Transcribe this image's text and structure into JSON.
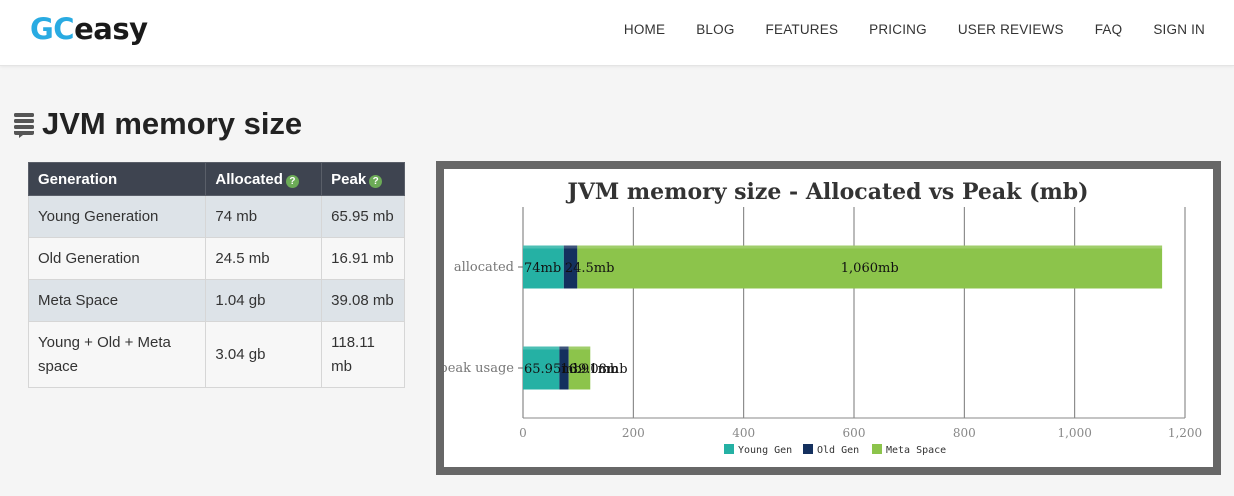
{
  "header": {
    "logo_gc": "GC",
    "logo_easy": "easy",
    "nav": [
      "HOME",
      "BLOG",
      "FEATURES",
      "PRICING",
      "USER REVIEWS",
      "FAQ",
      "SIGN IN"
    ]
  },
  "page": {
    "title": "JVM memory size"
  },
  "table": {
    "headers": [
      "Generation",
      "Allocated",
      "Peak"
    ],
    "rows": [
      {
        "generation": "Young Generation",
        "allocated": "74 mb",
        "peak": "65.95 mb"
      },
      {
        "generation": "Old Generation",
        "allocated": "24.5 mb",
        "peak": "16.91 mb"
      },
      {
        "generation": "Meta Space",
        "allocated": "1.04 gb",
        "peak": "39.08 mb"
      },
      {
        "generation": "Young + Old + Meta space",
        "allocated": "3.04 gb",
        "peak": "118.11 mb"
      }
    ]
  },
  "colors": {
    "young": "#25b1a4",
    "old": "#14305e",
    "meta": "#8cc44b"
  },
  "chart_data": {
    "type": "bar",
    "orientation": "horizontal",
    "stacked": true,
    "title": "JVM memory size - Allocated vs Peak (mb)",
    "categories": [
      "allocated",
      "peak usage"
    ],
    "series": [
      {
        "name": "Young Gen",
        "values": [
          74,
          65.95
        ],
        "labels": [
          "74mb",
          "65.95mb"
        ]
      },
      {
        "name": "Old Gen",
        "values": [
          24.5,
          16.91
        ],
        "labels": [
          "24.5mb",
          "16.91mb"
        ]
      },
      {
        "name": "Meta Space",
        "values": [
          1060,
          39.08
        ],
        "labels": [
          "1,060mb",
          "39.08mb"
        ]
      }
    ],
    "x_ticks": [
      "0",
      "200",
      "400",
      "600",
      "800",
      "1,000",
      "1,200"
    ],
    "xlim": [
      0,
      1200
    ],
    "grid": true,
    "legend_position": "bottom"
  }
}
